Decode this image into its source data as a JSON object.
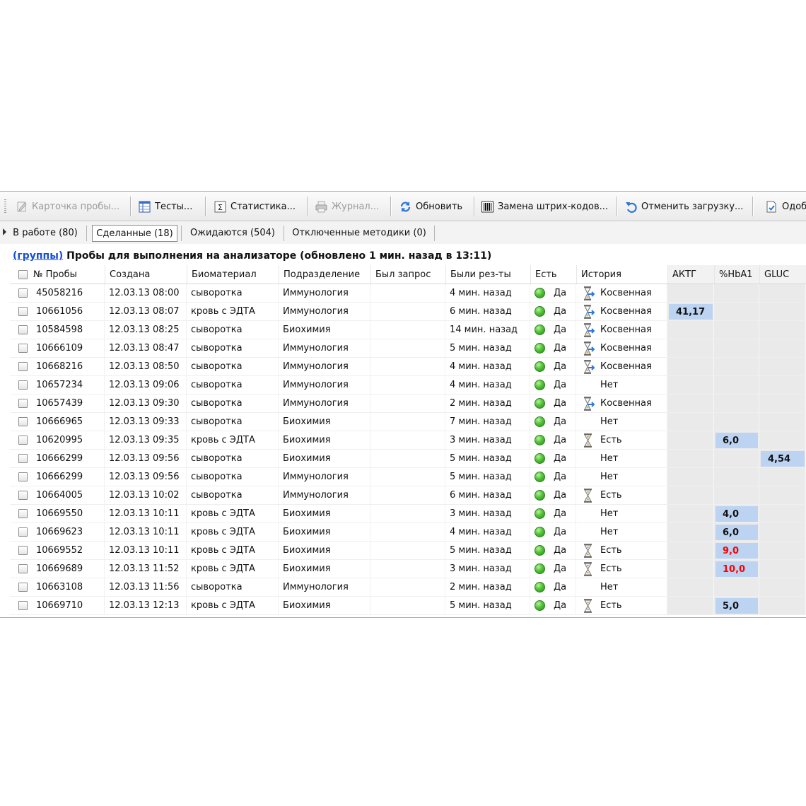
{
  "toolbar": {
    "buttons": [
      {
        "label": "Карточка пробы...",
        "icon": "card-icon",
        "enabled": false
      },
      {
        "label": "Тесты...",
        "icon": "tests-table-icon",
        "enabled": true
      },
      {
        "label": "Статистика...",
        "icon": "sigma-icon",
        "enabled": true
      },
      {
        "label": "Журнал...",
        "icon": "printer-icon",
        "enabled": false
      },
      {
        "label": "Обновить",
        "icon": "refresh-icon",
        "enabled": true
      },
      {
        "label": "Замена штрих-кодов...",
        "icon": "barcode-icon",
        "enabled": true
      },
      {
        "label": "Отменить загрузку...",
        "icon": "undo-icon",
        "enabled": true
      },
      {
        "label": "Одоб",
        "icon": "approve-icon",
        "enabled": true
      }
    ]
  },
  "tabs": [
    {
      "label": "В работе (80)",
      "active": false
    },
    {
      "label": "Сделанные (18)",
      "active": true
    },
    {
      "label": "Ожидаются (504)",
      "active": false
    },
    {
      "label": "Отключенные методики (0)",
      "active": false
    }
  ],
  "header": {
    "groups_link": "(группы)",
    "title": "Пробы для выполнения на анализаторе (обновлено 1 мин. назад в 13:11)"
  },
  "table": {
    "columns": [
      "№ Пробы",
      "Создана",
      "Биоматериал",
      "Подразделение",
      "Был запрос",
      "Были рез-ты",
      "Есть",
      "История",
      "АКТГ",
      "%HbA1",
      "GLUC"
    ],
    "rows": [
      {
        "id": "45058216",
        "created": "12.03.13 08:00",
        "bio": "сыворотка",
        "dept": "Иммунология",
        "req": "",
        "results": "4 мин. назад",
        "has": "Да",
        "history": "Косвенная",
        "hist_icon": "hourglass-arrow-icon",
        "aktg": "",
        "hba1": "",
        "gluc": "",
        "red": false
      },
      {
        "id": "10661056",
        "created": "12.03.13 08:07",
        "bio": "кровь с ЭДТА",
        "dept": "Иммунология",
        "req": "",
        "results": "6 мин. назад",
        "has": "Да",
        "history": "Косвенная",
        "hist_icon": "hourglass-arrow-icon",
        "aktg": "41,17",
        "hba1": "",
        "gluc": "",
        "red": false
      },
      {
        "id": "10584598",
        "created": "12.03.13 08:25",
        "bio": "сыворотка",
        "dept": "Биохимия",
        "req": "",
        "results": "14 мин. назад",
        "has": "Да",
        "history": "Косвенная",
        "hist_icon": "hourglass-arrow-icon",
        "aktg": "",
        "hba1": "",
        "gluc": "",
        "red": false
      },
      {
        "id": "10666109",
        "created": "12.03.13 08:47",
        "bio": "сыворотка",
        "dept": "Иммунология",
        "req": "",
        "results": "5 мин. назад",
        "has": "Да",
        "history": "Косвенная",
        "hist_icon": "hourglass-arrow-icon",
        "aktg": "",
        "hba1": "",
        "gluc": "",
        "red": false
      },
      {
        "id": "10668216",
        "created": "12.03.13 08:50",
        "bio": "сыворотка",
        "dept": "Иммунология",
        "req": "",
        "results": "4 мин. назад",
        "has": "Да",
        "history": "Косвенная",
        "hist_icon": "hourglass-arrow-icon",
        "aktg": "",
        "hba1": "",
        "gluc": "",
        "red": false
      },
      {
        "id": "10657234",
        "created": "12.03.13 09:06",
        "bio": "сыворотка",
        "dept": "Иммунология",
        "req": "",
        "results": "4 мин. назад",
        "has": "Да",
        "history": "Нет",
        "hist_icon": "",
        "aktg": "",
        "hba1": "",
        "gluc": "",
        "red": false
      },
      {
        "id": "10657439",
        "created": "12.03.13 09:30",
        "bio": "сыворотка",
        "dept": "Иммунология",
        "req": "",
        "results": "2 мин. назад",
        "has": "Да",
        "history": "Косвенная",
        "hist_icon": "hourglass-arrow-icon",
        "aktg": "",
        "hba1": "",
        "gluc": "",
        "red": false
      },
      {
        "id": "10666965",
        "created": "12.03.13 09:33",
        "bio": "сыворотка",
        "dept": "Биохимия",
        "req": "",
        "results": "7 мин. назад",
        "has": "Да",
        "history": "Нет",
        "hist_icon": "",
        "aktg": "",
        "hba1": "",
        "gluc": "",
        "red": false
      },
      {
        "id": "10620995",
        "created": "12.03.13 09:35",
        "bio": "кровь с ЭДТА",
        "dept": "Биохимия",
        "req": "",
        "results": "3 мин. назад",
        "has": "Да",
        "history": "Есть",
        "hist_icon": "hourglass-icon",
        "aktg": "",
        "hba1": "6,0",
        "gluc": "",
        "red": false
      },
      {
        "id": "10666299",
        "created": "12.03.13 09:56",
        "bio": "сыворотка",
        "dept": "Биохимия",
        "req": "",
        "results": "5 мин. назад",
        "has": "Да",
        "history": "Нет",
        "hist_icon": "",
        "aktg": "",
        "hba1": "",
        "gluc": "4,54",
        "red": false
      },
      {
        "id": "10666299",
        "created": "12.03.13 09:56",
        "bio": "сыворотка",
        "dept": "Иммунология",
        "req": "",
        "results": "5 мин. назад",
        "has": "Да",
        "history": "Нет",
        "hist_icon": "",
        "aktg": "",
        "hba1": "",
        "gluc": "",
        "red": false
      },
      {
        "id": "10664005",
        "created": "12.03.13 10:02",
        "bio": "сыворотка",
        "dept": "Иммунология",
        "req": "",
        "results": "6 мин. назад",
        "has": "Да",
        "history": "Есть",
        "hist_icon": "hourglass-icon",
        "aktg": "",
        "hba1": "",
        "gluc": "",
        "red": false
      },
      {
        "id": "10669550",
        "created": "12.03.13 10:11",
        "bio": "кровь с ЭДТА",
        "dept": "Биохимия",
        "req": "",
        "results": "3 мин. назад",
        "has": "Да",
        "history": "Нет",
        "hist_icon": "",
        "aktg": "",
        "hba1": "4,0",
        "gluc": "",
        "red": false
      },
      {
        "id": "10669623",
        "created": "12.03.13 10:11",
        "bio": "кровь с ЭДТА",
        "dept": "Биохимия",
        "req": "",
        "results": "4 мин. назад",
        "has": "Да",
        "history": "Нет",
        "hist_icon": "",
        "aktg": "",
        "hba1": "6,0",
        "gluc": "",
        "red": false
      },
      {
        "id": "10669552",
        "created": "12.03.13 10:11",
        "bio": "кровь с ЭДТА",
        "dept": "Биохимия",
        "req": "",
        "results": "5 мин. назад",
        "has": "Да",
        "history": "Есть",
        "hist_icon": "hourglass-icon",
        "aktg": "",
        "hba1": "9,0",
        "gluc": "",
        "red": true
      },
      {
        "id": "10669689",
        "created": "12.03.13 11:52",
        "bio": "кровь с ЭДТА",
        "dept": "Биохимия",
        "req": "",
        "results": "3 мин. назад",
        "has": "Да",
        "history": "Есть",
        "hist_icon": "hourglass-icon",
        "aktg": "",
        "hba1": "10,0",
        "gluc": "",
        "red": true
      },
      {
        "id": "10663108",
        "created": "12.03.13 11:56",
        "bio": "сыворотка",
        "dept": "Иммунология",
        "req": "",
        "results": "2 мин. назад",
        "has": "Да",
        "history": "Нет",
        "hist_icon": "",
        "aktg": "",
        "hba1": "",
        "gluc": "",
        "red": false
      },
      {
        "id": "10669710",
        "created": "12.03.13 12:13",
        "bio": "кровь с ЭДТА",
        "dept": "Биохимия",
        "req": "",
        "results": "5 мин. назад",
        "has": "Да",
        "history": "Есть",
        "hist_icon": "hourglass-icon",
        "aktg": "",
        "hba1": "5,0",
        "gluc": "",
        "red": false
      }
    ]
  },
  "colors": {
    "value_highlight": "#bcd4f2",
    "value_alert": "#ff0000",
    "link": "#1a4fd0",
    "measurement_column_bg": "#eaeaea"
  }
}
